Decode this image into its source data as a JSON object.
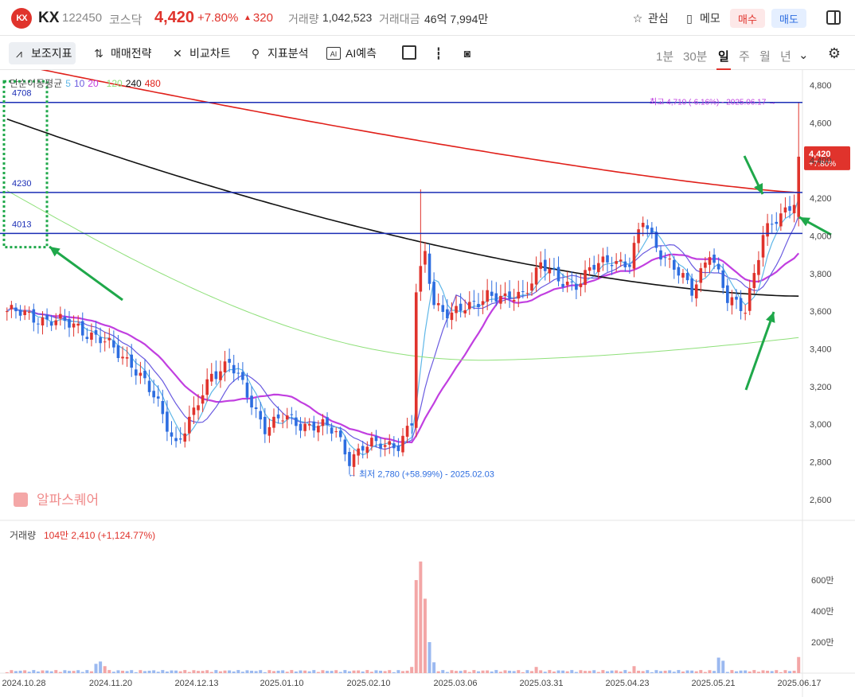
{
  "header": {
    "logo_text": "KX",
    "name": "KX",
    "code": "122450",
    "market": "코스닥",
    "price": "4,420",
    "change_pct": "+7.80%",
    "change": "320",
    "volume_label": "거래량",
    "volume": "1,042,523",
    "amount_label": "거래대금",
    "amount": "46억 7,994만",
    "watch_label": "관심",
    "memo_label": "메모",
    "buy_label": "매수",
    "sell_label": "매도"
  },
  "toolbar": {
    "indicator_label": "보조지표",
    "strategy_label": "매매전략",
    "compare_label": "비교차트",
    "analysis_label": "지표분석",
    "ai_label": "AI예측",
    "periods": [
      "1분",
      "30분",
      "일",
      "주",
      "월",
      "년"
    ],
    "selected_period": "일"
  },
  "colors": {
    "up": "#e0332c",
    "down": "#2d6de0",
    "ma5": "#5fb7e8",
    "ma10": "#6a5be0",
    "ma20": "#c13fe0",
    "ma120": "#8fe07a",
    "ma240": "#111111",
    "ma480": "#e0201a",
    "level": "#1a2db5",
    "box": "#1fa84a",
    "arrow": "#1fa84a"
  },
  "chart_data": {
    "type": "candlestick",
    "legend": {
      "title": "단순이동평균",
      "periods": [
        "5",
        "10",
        "20",
        "120",
        "240",
        "480"
      ]
    },
    "y_axis": {
      "ticks": [
        2600,
        2800,
        3000,
        3200,
        3400,
        3600,
        3800,
        4000,
        4200,
        4400,
        4600,
        4800
      ],
      "labels": [
        "2,600",
        "2,800",
        "3,000",
        "3,200",
        "3,400",
        "3,600",
        "3,800",
        "4,000",
        "4,200",
        "4,400",
        "4,600",
        "4,800"
      ],
      "range": [
        2490,
        4880
      ]
    },
    "x_axis": {
      "labels": [
        "2024.10.28",
        "2024.11.20",
        "2024.12.13",
        "2025.01.10",
        "2025.02.10",
        "2025.03.06",
        "2025.03.31",
        "2025.04.23",
        "2025.05.21",
        "2025.06.17"
      ]
    },
    "levels": [
      {
        "value": 4708,
        "label": "4708"
      },
      {
        "value": 4230,
        "label": "4230"
      },
      {
        "value": 4013,
        "label": "4013"
      }
    ],
    "high_annotation": "최고 4,710 (-6.16%) - 2025.06.17",
    "low_annotation": "최저 2,780 (+58.99%) - 2025.02.03",
    "last_price_tag": {
      "price": "4,420",
      "pct": "+7.80%"
    },
    "ohlc_keyframes": [
      [
        0,
        3600
      ],
      [
        8,
        3560
      ],
      [
        16,
        3520
      ],
      [
        22,
        3430
      ],
      [
        28,
        3330
      ],
      [
        34,
        3100
      ],
      [
        38,
        2900
      ],
      [
        42,
        3050
      ],
      [
        46,
        3270
      ],
      [
        50,
        3330
      ],
      [
        54,
        3150
      ],
      [
        58,
        2990
      ],
      [
        62,
        3030
      ],
      [
        66,
        3000
      ],
      [
        70,
        3000
      ],
      [
        74,
        2950
      ],
      [
        77,
        2820
      ],
      [
        80,
        2880
      ],
      [
        84,
        2890
      ],
      [
        88,
        2900
      ],
      [
        91,
        3000
      ],
      [
        92,
        3700
      ],
      [
        94,
        3900
      ],
      [
        96,
        3650
      ],
      [
        100,
        3580
      ],
      [
        104,
        3620
      ],
      [
        108,
        3700
      ],
      [
        112,
        3650
      ],
      [
        116,
        3700
      ],
      [
        120,
        3850
      ],
      [
        124,
        3760
      ],
      [
        128,
        3750
      ],
      [
        132,
        3830
      ],
      [
        136,
        3880
      ],
      [
        140,
        3850
      ],
      [
        143,
        4080
      ],
      [
        146,
        3950
      ],
      [
        150,
        3830
      ],
      [
        154,
        3700
      ],
      [
        158,
        3930
      ],
      [
        162,
        3650
      ],
      [
        166,
        3620
      ],
      [
        170,
        4000
      ],
      [
        174,
        4100
      ],
      [
        177,
        4200
      ],
      [
        178,
        4420
      ]
    ],
    "volume": {
      "label": "거래량",
      "value_text": "104만 2,410 (+1,124.77%)",
      "ticks": [
        200,
        400,
        600
      ],
      "tick_labels": [
        "200만",
        "400만",
        "600만"
      ],
      "unit": "만",
      "spikes": [
        [
          20,
          60
        ],
        [
          21,
          75
        ],
        [
          22,
          45
        ],
        [
          91,
          40
        ],
        [
          92,
          600
        ],
        [
          93,
          720
        ],
        [
          94,
          480
        ],
        [
          95,
          200
        ],
        [
          96,
          70
        ],
        [
          119,
          40
        ],
        [
          141,
          45
        ],
        [
          160,
          100
        ],
        [
          161,
          80
        ],
        [
          178,
          104
        ]
      ]
    },
    "watermark": "알파스퀘어"
  }
}
